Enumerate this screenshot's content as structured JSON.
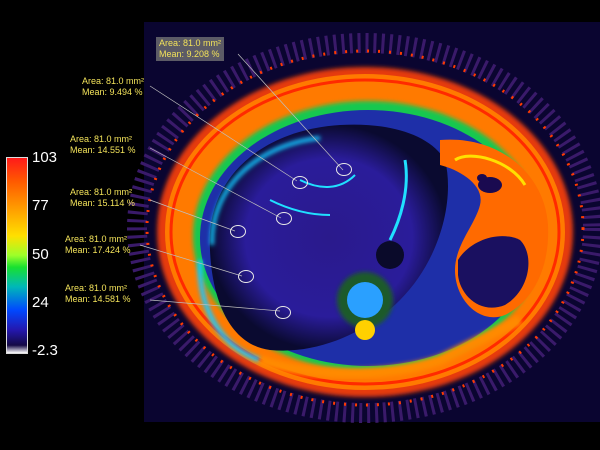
{
  "colorbar": {
    "max_label": "103",
    "tick_77": "77",
    "tick_50": "50",
    "tick_24": "24",
    "min_label": "-2.3"
  },
  "measurements": [
    {
      "area": "Area: 81.0 mm²",
      "mean": "Mean: 9.208 %"
    },
    {
      "area": "Area: 81.0 mm²",
      "mean": "Mean: 9.494 %"
    },
    {
      "area": "Area: 81.0 mm²",
      "mean": "Mean: 14.551 %"
    },
    {
      "area": "Area: 81.0 mm²",
      "mean": "Mean: 15.114 %"
    },
    {
      "area": "Area: 81.0 mm²",
      "mean": "Mean: 17.424 %"
    },
    {
      "area": "Area: 81.0 mm²",
      "mean": "Mean: 14.581 %"
    }
  ]
}
